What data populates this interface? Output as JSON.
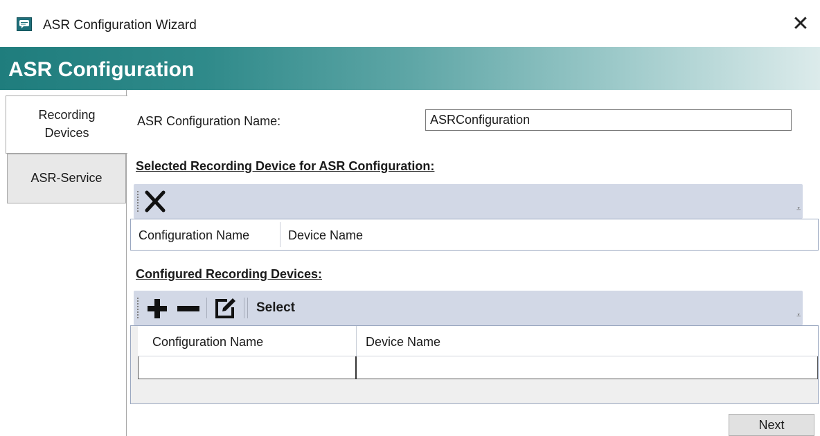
{
  "window": {
    "title": "ASR Configuration Wizard",
    "close_glyph": "✕"
  },
  "banner": {
    "title": "ASR Configuration",
    "gradient_colors": [
      "#1f7d7d",
      "#dcebeb"
    ]
  },
  "tabs": [
    {
      "label_line1": "Recording",
      "label_line2": "Devices",
      "selected": true
    },
    {
      "label": "ASR-Service",
      "selected": false
    }
  ],
  "form": {
    "name_label": "ASR Configuration Name:",
    "name_value": "ASRConfiguration"
  },
  "selected_section": {
    "title": "Selected Recording Device for ASR Configuration:",
    "toolbar_icons": [
      "delete-x-icon"
    ],
    "columns": [
      "Configuration Name",
      "Device Name"
    ]
  },
  "configured_section": {
    "title": "Configured Recording Devices:",
    "toolbar_icons": [
      "add-icon",
      "remove-icon",
      "edit-icon"
    ],
    "select_label": "Select",
    "columns": [
      "Configuration Name",
      "Device Name"
    ],
    "rows": [
      [
        "",
        ""
      ]
    ]
  },
  "footer": {
    "next_label": "Next"
  },
  "toolbar_more_glyph": "⩡",
  "colors": {
    "toolbar_bg": "#d2d8e6",
    "button_bg": "#e1e1e1"
  }
}
